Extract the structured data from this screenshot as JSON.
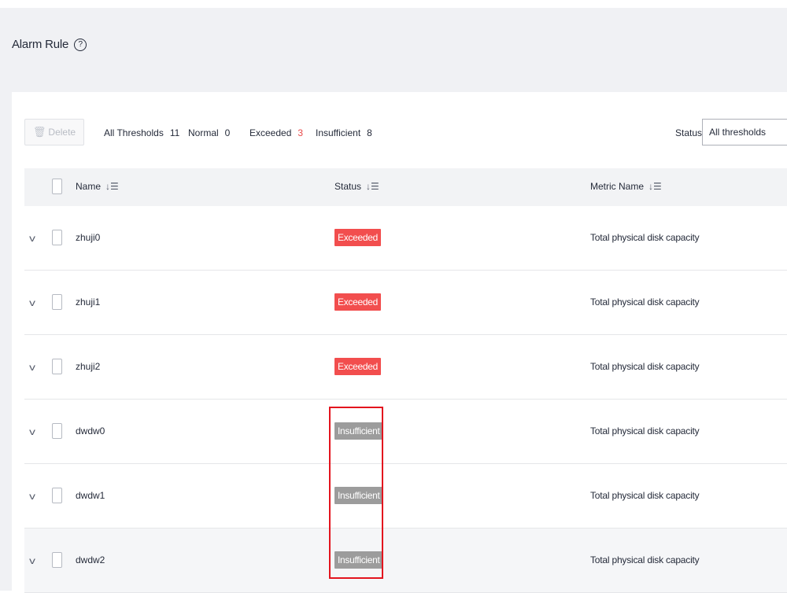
{
  "page": {
    "title": "Alarm Rule",
    "help_icon": "?"
  },
  "toolbar": {
    "delete_label": "Delete",
    "stats": [
      {
        "label": "All Thresholds",
        "count": "11",
        "count_color": "#252b3a"
      },
      {
        "label": "Normal",
        "count": "0",
        "count_color": "#252b3a"
      },
      {
        "label": "Exceeded",
        "count": "3",
        "count_color": "#e84a4a"
      },
      {
        "label": "Insufficient",
        "count": "8",
        "count_color": "#252b3a"
      }
    ],
    "status_filter_label": "Status",
    "status_filter_value": "All thresholds"
  },
  "table": {
    "columns": [
      "Name",
      "Status",
      "Metric Name"
    ],
    "rows": [
      {
        "name": "zhuji0",
        "status": "Exceeded",
        "status_color": "#f24e4e",
        "metric": "Total physical disk capacity"
      },
      {
        "name": "zhuji1",
        "status": "Exceeded",
        "status_color": "#f24e4e",
        "metric": "Total physical disk capacity"
      },
      {
        "name": "zhuji2",
        "status": "Exceeded",
        "status_color": "#f24e4e",
        "metric": "Total physical disk capacity"
      },
      {
        "name": "dwdw0",
        "status": "Insufficient",
        "status_color": "#9c9c9c",
        "metric": "Total physical disk capacity"
      },
      {
        "name": "dwdw1",
        "status": "Insufficient",
        "status_color": "#9c9c9c",
        "metric": "Total physical disk capacity"
      },
      {
        "name": "dwdw2",
        "status": "Insufficient",
        "status_color": "#9c9c9c",
        "metric": "Total physical disk capacity"
      }
    ]
  },
  "icons": {
    "help": "help-icon",
    "delete": "trash-icon",
    "sort": "sort-icon",
    "expand": "chevron-down-icon"
  }
}
